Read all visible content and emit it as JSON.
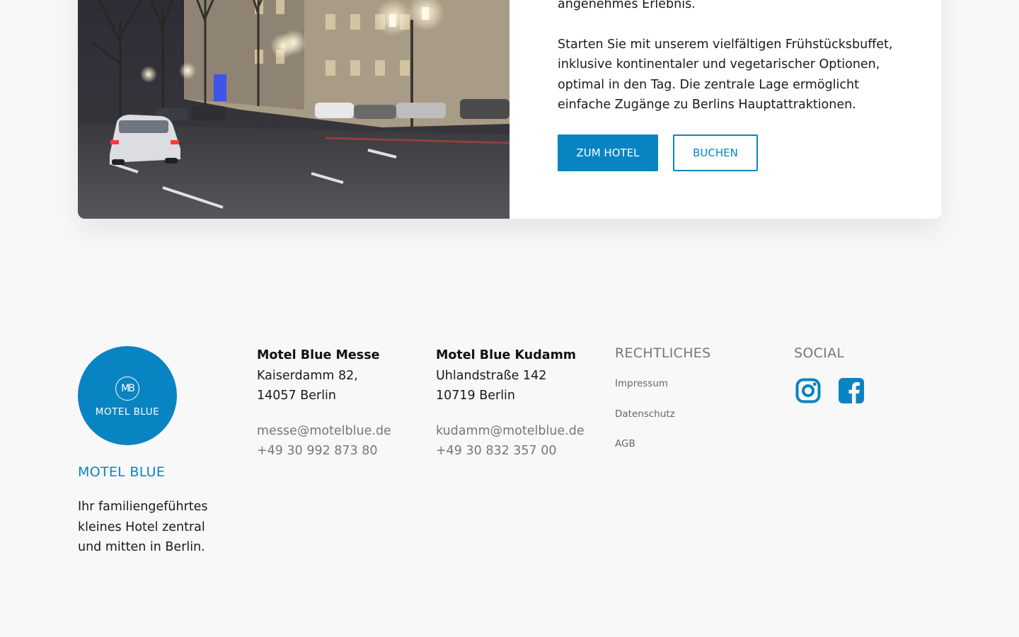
{
  "hotel_card": {
    "text_tail": "angenehmes Erlebnis.",
    "text_main": "Starten Sie mit unserem vielfältigen Frühstücksbuffet, inklusive kontinentaler und vegetarischer Optionen, optimal in den Tag. Die zentrale Lage ermöglicht einfache Zugänge zu Berlins Hauptattraktionen.",
    "primary_button": "ZUM HOTEL",
    "secondary_button": "BUCHEN"
  },
  "footer": {
    "logo_monogram": "MB",
    "logo_text": "MOTEL BLUE",
    "brand_title": "MOTEL BLUE",
    "brand_description": "Ihr familiengeführtes kleines Hotel zentral und mitten in Berlin.",
    "locations": [
      {
        "name": "Motel Blue Messe",
        "street": "Kaiserdamm 82,",
        "city": "14057 Berlin",
        "email": "messe@motelblue.de",
        "phone": "+49 30 992 873 80"
      },
      {
        "name": "Motel Blue Kudamm",
        "street": "Uhlandstraße 142",
        "city": "10719 Berlin",
        "email": "kudamm@motelblue.de",
        "phone": "+49 30 832 357 00"
      }
    ],
    "legal": {
      "heading": "RECHTLICHES",
      "links": [
        "Impressum",
        "Datenschutz",
        "AGB"
      ]
    },
    "social": {
      "heading": "SOCIAL",
      "icons": [
        "instagram-icon",
        "facebook-icon"
      ]
    }
  },
  "colors": {
    "brand_blue": "#0984c3",
    "background": "#f8f8f8",
    "muted_text": "#777777"
  }
}
